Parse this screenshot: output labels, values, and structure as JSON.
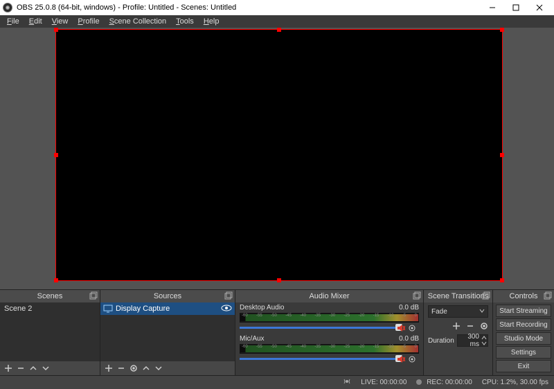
{
  "window": {
    "title": "OBS 25.0.8 (64-bit, windows) - Profile: Untitled - Scenes: Untitled"
  },
  "menu": {
    "file": "File",
    "edit": "Edit",
    "view": "View",
    "profile": "Profile",
    "scene_collection": "Scene Collection",
    "tools": "Tools",
    "help": "Help"
  },
  "panels": {
    "scenes_title": "Scenes",
    "sources_title": "Sources",
    "mixer_title": "Audio Mixer",
    "transitions_title": "Scene Transitions",
    "controls_title": "Controls"
  },
  "scenes": {
    "items": [
      {
        "name": "Scene 2"
      }
    ]
  },
  "sources": {
    "items": [
      {
        "name": "Display Capture",
        "visible": true
      }
    ]
  },
  "mixer": {
    "channels": [
      {
        "name": "Desktop Audio",
        "level": "0.0 dB",
        "muted": true
      },
      {
        "name": "Mic/Aux",
        "level": "0.0 dB",
        "muted": true
      }
    ],
    "ticks": [
      "-60",
      "-55",
      "-50",
      "-45",
      "-40",
      "-35",
      "-30",
      "-25",
      "-20",
      "-15",
      "-10",
      "-5",
      "0"
    ]
  },
  "transitions": {
    "current": "Fade",
    "duration_label": "Duration",
    "duration_value": "300 ms"
  },
  "controls": {
    "start_streaming": "Start Streaming",
    "start_recording": "Start Recording",
    "studio_mode": "Studio Mode",
    "settings": "Settings",
    "exit": "Exit"
  },
  "status": {
    "live_label": "LIVE:",
    "live_time": "00:00:00",
    "rec_label": "REC:",
    "rec_time": "00:00:00",
    "cpu": "CPU: 1.2%, 30.00 fps"
  },
  "icons": {
    "plus": "+",
    "minus": "—"
  }
}
